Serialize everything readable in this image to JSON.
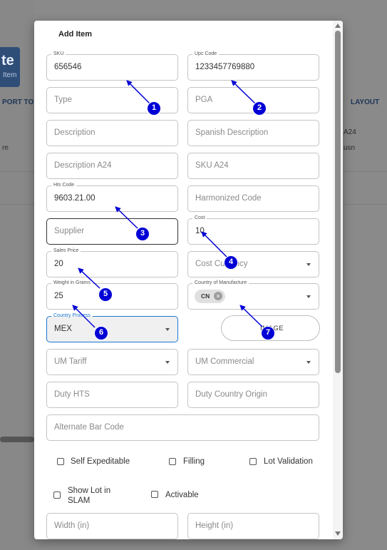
{
  "background": {
    "logo_text": "te",
    "logo_subtext": "Item",
    "report_text": "PORT TO C",
    "layout_text": "LAYOUT",
    "left_row_text": "re",
    "right_row_text_1": "A24",
    "right_row_text_2": "usn"
  },
  "modal": {
    "title": "Add Item",
    "fields": {
      "sku": {
        "label": "SKU",
        "value": "656546"
      },
      "upc_code": {
        "label": "Upc Code",
        "value": "1233457769880"
      },
      "type": {
        "placeholder": "Type"
      },
      "pga": {
        "placeholder": "PGA"
      },
      "description": {
        "placeholder": "Description"
      },
      "spanish_description": {
        "placeholder": "Spanish Description"
      },
      "description_a24": {
        "placeholder": "Description A24"
      },
      "sku_a24": {
        "placeholder": "SKU A24"
      },
      "hts_code": {
        "label": "Hts Code",
        "value": "9603.21.00"
      },
      "harmonized_code": {
        "placeholder": "Harmonized Code"
      },
      "supplier": {
        "placeholder": "Supplier"
      },
      "cost": {
        "label": "Cost",
        "value": "10"
      },
      "sales_price": {
        "label": "Sales Price",
        "value": "20"
      },
      "cost_currency": {
        "placeholder": "Cost Currency"
      },
      "weight_grams": {
        "label": "Weight in Grams",
        "value": "25"
      },
      "country_manufacture": {
        "label": "Country of Manufacture",
        "chip": "CN"
      },
      "country_process": {
        "label": "Country Process",
        "value": "MEX"
      },
      "um_tariff": {
        "placeholder": "UM Tariff"
      },
      "um_commercial": {
        "placeholder": "UM Commercial"
      },
      "duty_hts": {
        "placeholder": "Duty HTS"
      },
      "duty_country_origin": {
        "placeholder": "Duty Country Origin"
      },
      "alternate_bar_code": {
        "placeholder": "Alternate Bar Code"
      },
      "width": {
        "placeholder": "Width (in)"
      },
      "height": {
        "placeholder": "Height (in)"
      }
    },
    "image_button": "IMAGE",
    "checkboxes": {
      "self_expeditable": "Self Expeditable",
      "filling": "Filling",
      "lot_validation": "Lot Validation",
      "show_lot_slam": "Show Lot in SLAM",
      "activable": "Activable"
    }
  },
  "annotations": [
    "1",
    "2",
    "3",
    "4",
    "5",
    "6",
    "7"
  ],
  "colors": {
    "annotation": "#0000d6",
    "focus": "#1976d2"
  }
}
